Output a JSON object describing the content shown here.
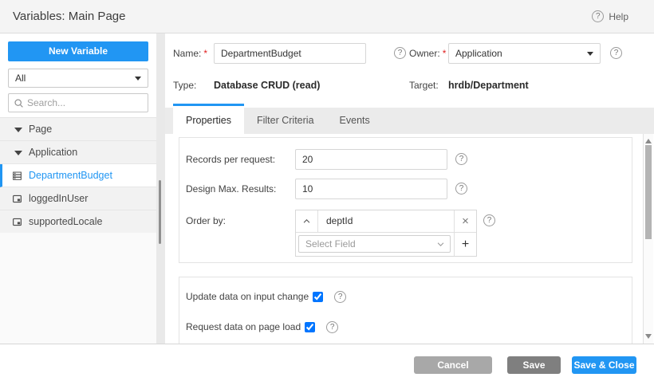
{
  "colors": {
    "accent": "#2196f3",
    "required": "#e02020",
    "cancel_button": "#a8a8a8",
    "save_button": "#7f7f7f"
  },
  "icons": {
    "help_glyph": "?",
    "close_glyph": "×",
    "add_glyph": "+"
  },
  "header": {
    "title": "Variables: Main Page",
    "help_label": "Help"
  },
  "sidebar": {
    "new_variable_button": "New Variable",
    "filter_selected": "All",
    "search_placeholder": "Search...",
    "tree": [
      {
        "label": "Page",
        "type": "group",
        "expanded": true
      },
      {
        "label": "Application",
        "type": "group",
        "expanded": true
      },
      {
        "label": "DepartmentBudget",
        "type": "crud-variable",
        "selected": true
      },
      {
        "label": "loggedInUser",
        "type": "static-variable",
        "selected": false
      },
      {
        "label": "supportedLocale",
        "type": "static-variable",
        "selected": false
      }
    ]
  },
  "form": {
    "required_marker": "*",
    "name_label": "Name:",
    "name_value": "DepartmentBudget",
    "owner_label": "Owner:",
    "owner_value": "Application",
    "type_label": "Type:",
    "type_value": "Database CRUD (read)",
    "target_label": "Target:",
    "target_value": "hrdb/Department"
  },
  "tabs": [
    {
      "label": "Properties",
      "active": true
    },
    {
      "label": "Filter Criteria",
      "active": false
    },
    {
      "label": "Events",
      "active": false
    }
  ],
  "properties": {
    "records_label": "Records per request:",
    "records_value": "20",
    "design_max_label": "Design Max. Results:",
    "design_max_value": "10",
    "order_by_label": "Order by:",
    "order_field_value": "deptId",
    "select_field_placeholder": "Select Field",
    "update_on_change_label": "Update data on input change",
    "update_on_change_checked": true,
    "request_on_load_label": "Request data on page load",
    "request_on_load_checked": true
  },
  "footer": {
    "cancel_label": "Cancel",
    "save_label": "Save",
    "save_close_label": "Save & Close"
  }
}
